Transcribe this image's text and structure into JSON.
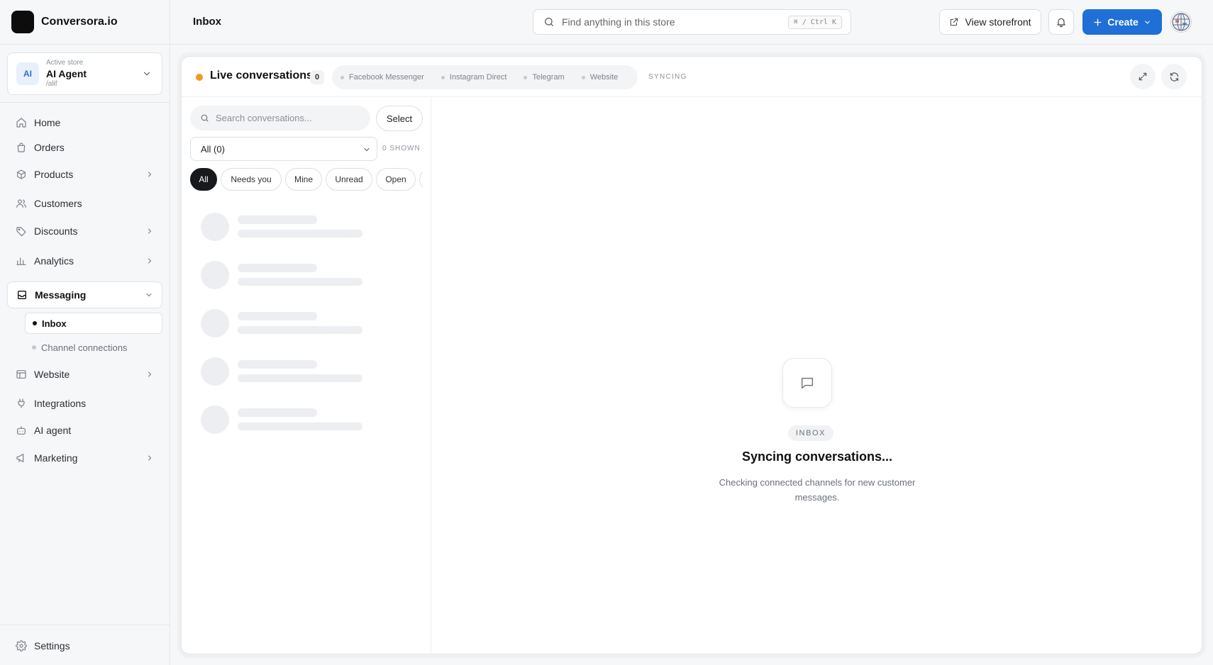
{
  "brand": {
    "name": "Conversora.io"
  },
  "store": {
    "label": "Active store",
    "avatar": "AI",
    "name": "AI Agent",
    "path": "/alif"
  },
  "nav": {
    "items": [
      {
        "label": "Home",
        "icon": "home-icon"
      },
      {
        "label": "Orders",
        "icon": "bag-icon"
      },
      {
        "label": "Products",
        "icon": "box-icon",
        "has_children": true
      },
      {
        "label": "Customers",
        "icon": "users-icon"
      },
      {
        "label": "Discounts",
        "icon": "tag-icon",
        "has_children": true
      },
      {
        "label": "Analytics",
        "icon": "bar-chart-icon",
        "has_children": true
      },
      {
        "label": "Messaging",
        "icon": "inbox-icon",
        "expanded": true,
        "active": true
      },
      {
        "label": "Website",
        "icon": "layout-icon",
        "has_children": true
      },
      {
        "label": "Integrations",
        "icon": "plug-icon"
      },
      {
        "label": "AI agent",
        "icon": "bot-icon"
      },
      {
        "label": "Marketing",
        "icon": "megaphone-icon",
        "has_children": true
      }
    ],
    "messaging_children": [
      {
        "label": "Inbox",
        "active": true
      },
      {
        "label": "Channel connections"
      }
    ],
    "settings": {
      "label": "Settings",
      "icon": "gear-icon"
    }
  },
  "topbar": {
    "title": "Inbox",
    "search_placeholder": "Find anything in this store",
    "shortcut": "⌘ / Ctrl K",
    "storefront_label": "View storefront",
    "create_label": "Create"
  },
  "conversations": {
    "title": "Live conversations",
    "count": "0",
    "channels": [
      "Facebook Messenger",
      "Instagram Direct",
      "Telegram",
      "Website"
    ],
    "status": "SYNCING",
    "search_placeholder": "Search conversations...",
    "select_label": "Select",
    "filter_value": "All (0)",
    "shown_label": "0 SHOWN",
    "chips": [
      "All",
      "Needs you",
      "Mine",
      "Unread",
      "Open"
    ]
  },
  "empty_state": {
    "tag": "INBOX",
    "title": "Syncing conversations...",
    "subtitle": "Checking connected channels for new customer messages."
  },
  "colors": {
    "accent": "#1f6fd6",
    "live_dot": "#f29a1a",
    "chip_active": "#17191c"
  }
}
